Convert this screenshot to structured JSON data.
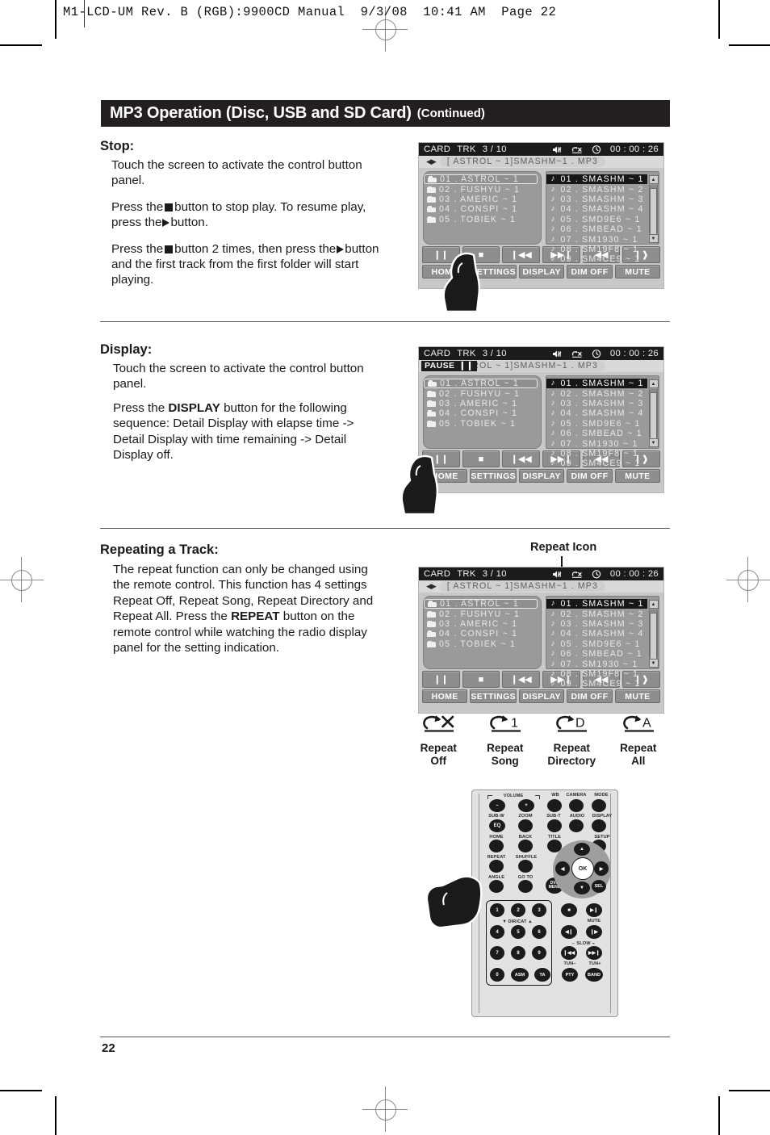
{
  "printmarks": {
    "filestamp": "M1-LCD-UM Rev. B (RGB):9900CD Manual  9/3/08  10:41 AM  Page 22"
  },
  "header": {
    "title_main": "MP3 Operation (Disc, USB and SD Card)",
    "title_suffix": "(Continued)"
  },
  "page": {
    "number": "22"
  },
  "sections": {
    "stop": {
      "heading": "Stop:",
      "p1": "Touch the screen to activate the control button panel.",
      "p2_a": "Press the",
      "p2_b": "button to stop play. To resume play, press the",
      "p2_c": "button.",
      "p3_a": "Press the",
      "p3_b": "button 2 times, then press the",
      "p3_c": "button and the first track from the first folder will start playing."
    },
    "display": {
      "heading": "Display:",
      "p1": "Touch the screen to activate the control button panel.",
      "p2_a": "Press the",
      "p2_bold": "DISPLAY",
      "p2_b": "button for the following sequence: Detail Display with elapse time -> Detail Display with time remaining -> Detail Display off."
    },
    "repeating": {
      "heading": "Repeating a Track:",
      "p1_a": "The repeat function can only be changed using the remote control. This function has 4 settings Repeat Off, Repeat Song, Repeat Directory and Repeat All. Press the",
      "p1_bold": "REPEAT",
      "p1_b": "button on the remote control while watching the radio display panel for the setting indication."
    }
  },
  "lcd": {
    "status": {
      "source": "CARD",
      "trk_label": "TRK",
      "trk_value": "3 / 10",
      "icons": [
        "mute-icon",
        "repeat-icon",
        "clock-icon"
      ],
      "time": "00 : 00 : 26"
    },
    "file_bar": {
      "ff_icon": "fast-forward-icon",
      "filename": "[ ASTROL ~ 1]SMASHM~1 . MP3",
      "pause_label": "PAUSE"
    },
    "folders": [
      "01  . ASTROL ~ 1",
      "02  . FUSHYU ~ 1",
      "03  . AMERIC ~ 1",
      "04  . CONSPI ~ 1",
      "05  . TOBIEK ~ 1"
    ],
    "tracks": [
      "01 . SMASHM ~ 1",
      "02 . SMASHM ~ 2",
      "03 . SMASHM ~ 3",
      "04 . SMASHM ~ 4",
      "05 . SMD9E6 ~ 1",
      "06 . SMBEAD ~ 1",
      "07 . SM1930 ~ 1",
      "08 . SM19F8 ~ 1",
      "09 . SM4CE9 ~ 1"
    ],
    "transport": [
      {
        "name": "pause-button",
        "glyph": "❙❙"
      },
      {
        "name": "stop-button",
        "glyph": "■"
      },
      {
        "name": "previous-track-button",
        "glyph": "❙◀◀"
      },
      {
        "name": "next-track-button",
        "glyph": "▶▶❙"
      },
      {
        "name": "rewind-button",
        "glyph": "◀◀"
      },
      {
        "name": "fast-forward-button",
        "glyph": "❙❱"
      }
    ],
    "menu": [
      "HOME",
      "SETTINGS",
      "DISPLAY",
      "DIM OFF",
      "MUTE"
    ]
  },
  "repeat_callout": "Repeat Icon",
  "repeat_legend": [
    {
      "icon": "repeat-off-icon",
      "symbol": "X",
      "line1": "Repeat",
      "line2": "Off"
    },
    {
      "icon": "repeat-song-icon",
      "symbol": "1",
      "line1": "Repeat",
      "line2": "Song"
    },
    {
      "icon": "repeat-directory-icon",
      "symbol": "D",
      "line1": "Repeat",
      "line2": "Directory"
    },
    {
      "icon": "repeat-all-icon",
      "symbol": "A",
      "line1": "Repeat",
      "line2": "All"
    }
  ],
  "remote": {
    "labels": {
      "volume": "VOLUME",
      "wb": "WB",
      "camera": "CAMERA",
      "mode": "MODE",
      "subw": "SUB-W",
      "zoom": "ZOOM",
      "subt": "SUB-T",
      "audio": "AUDIO",
      "display": "DISPLAY",
      "home": "HOME",
      "back": "BACK",
      "title": "TITLE",
      "setup": "SETUP",
      "repeat": "REPEAT",
      "shuffle": "SHUFFLE",
      "angle": "ANGLE",
      "goto": "GO TO",
      "dvd_menu": "DVD\nMENU",
      "sel": "SEL",
      "ok": "OK",
      "eq": "EQ",
      "dircat": "DIR/CAT",
      "mute": "MUTE",
      "slow": "SLOW",
      "tun_minus": "TUN–",
      "tun_plus": "TUN+",
      "volume_minus": "–",
      "volume_plus": "+"
    },
    "numbers": [
      "1",
      "2",
      "3",
      "4",
      "5",
      "6",
      "7",
      "8",
      "9",
      "0"
    ],
    "bottom_row": [
      "ASM",
      "TA",
      "PTY",
      "BAND"
    ]
  },
  "colors": {
    "title_bar": "#231f20",
    "lcd_body": "#c8c8c8",
    "lcd_status": "#1b1b1b",
    "pane_bg": "#9a9a9a",
    "button_bg": "#8e8e8e",
    "text": "#1a1a1a"
  }
}
